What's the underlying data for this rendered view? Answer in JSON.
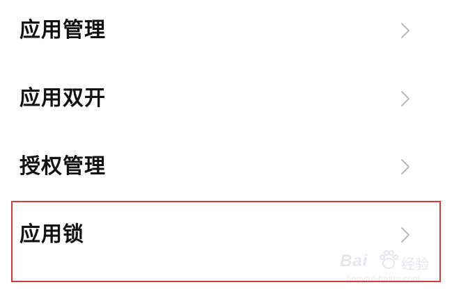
{
  "settings": {
    "items": [
      {
        "label": "应用管理",
        "icon": "chevron-right-icon"
      },
      {
        "label": "应用双开",
        "icon": "chevron-right-icon"
      },
      {
        "label": "授权管理",
        "icon": "chevron-right-icon"
      },
      {
        "label": "应用锁",
        "icon": "chevron-right-icon"
      }
    ],
    "highlighted_item": "应用锁"
  },
  "watermark": {
    "brand": "Bai",
    "sub": "经验",
    "url": "jingyan.baidu.com"
  },
  "colors": {
    "background": "#ffffff",
    "text": "#111111",
    "chevron": "#b8b8b8",
    "highlight_border": "#e0343b"
  }
}
